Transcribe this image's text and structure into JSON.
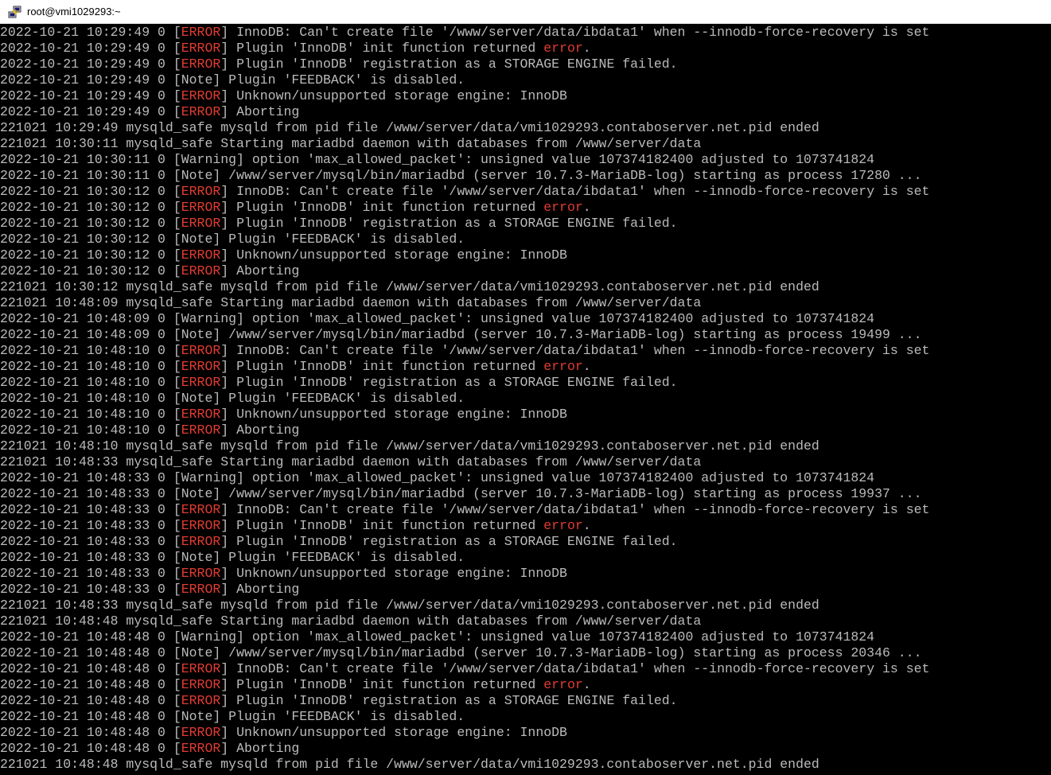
{
  "window": {
    "title": "root@vmi1029293:~",
    "icon": "putty-icon"
  },
  "colors": {
    "terminal_background": "#000000",
    "terminal_foreground": "#bbbbbb",
    "error_red": "#e03c31"
  },
  "terminal": {
    "lines": [
      {
        "pre": "2022-10-21 10:29:49 0 [",
        "red": "ERROR",
        "post": "] InnoDB: Can't create file '/www/server/data/ibdata1' when --innodb-force-recovery is set"
      },
      {
        "pre": "2022-10-21 10:29:49 0 [",
        "red": "ERROR",
        "post": "] Plugin 'InnoDB' init function returned ",
        "red2": "error",
        "post2": "."
      },
      {
        "pre": "2022-10-21 10:29:49 0 [",
        "red": "ERROR",
        "post": "] Plugin 'InnoDB' registration as a STORAGE ENGINE failed."
      },
      {
        "pre": "2022-10-21 10:29:49 0 [Note] Plugin 'FEEDBACK' is disabled."
      },
      {
        "pre": "2022-10-21 10:29:49 0 [",
        "red": "ERROR",
        "post": "] Unknown/unsupported storage engine: InnoDB"
      },
      {
        "pre": "2022-10-21 10:29:49 0 [",
        "red": "ERROR",
        "post": "] Aborting"
      },
      {
        "pre": "221021 10:29:49 mysqld_safe mysqld from pid file /www/server/data/vmi1029293.contaboserver.net.pid ended"
      },
      {
        "pre": "221021 10:30:11 mysqld_safe Starting mariadbd daemon with databases from /www/server/data"
      },
      {
        "pre": "2022-10-21 10:30:11 0 [Warning] option 'max_allowed_packet': unsigned value 107374182400 adjusted to 1073741824"
      },
      {
        "pre": "2022-10-21 10:30:11 0 [Note] /www/server/mysql/bin/mariadbd (server 10.7.3-MariaDB-log) starting as process 17280 ..."
      },
      {
        "pre": "2022-10-21 10:30:12 0 [",
        "red": "ERROR",
        "post": "] InnoDB: Can't create file '/www/server/data/ibdata1' when --innodb-force-recovery is set"
      },
      {
        "pre": "2022-10-21 10:30:12 0 [",
        "red": "ERROR",
        "post": "] Plugin 'InnoDB' init function returned ",
        "red2": "error",
        "post2": "."
      },
      {
        "pre": "2022-10-21 10:30:12 0 [",
        "red": "ERROR",
        "post": "] Plugin 'InnoDB' registration as a STORAGE ENGINE failed."
      },
      {
        "pre": "2022-10-21 10:30:12 0 [Note] Plugin 'FEEDBACK' is disabled."
      },
      {
        "pre": "2022-10-21 10:30:12 0 [",
        "red": "ERROR",
        "post": "] Unknown/unsupported storage engine: InnoDB"
      },
      {
        "pre": "2022-10-21 10:30:12 0 [",
        "red": "ERROR",
        "post": "] Aborting"
      },
      {
        "pre": "221021 10:30:12 mysqld_safe mysqld from pid file /www/server/data/vmi1029293.contaboserver.net.pid ended"
      },
      {
        "pre": "221021 10:48:09 mysqld_safe Starting mariadbd daemon with databases from /www/server/data"
      },
      {
        "pre": "2022-10-21 10:48:09 0 [Warning] option 'max_allowed_packet': unsigned value 107374182400 adjusted to 1073741824"
      },
      {
        "pre": "2022-10-21 10:48:09 0 [Note] /www/server/mysql/bin/mariadbd (server 10.7.3-MariaDB-log) starting as process 19499 ..."
      },
      {
        "pre": "2022-10-21 10:48:10 0 [",
        "red": "ERROR",
        "post": "] InnoDB: Can't create file '/www/server/data/ibdata1' when --innodb-force-recovery is set"
      },
      {
        "pre": "2022-10-21 10:48:10 0 [",
        "red": "ERROR",
        "post": "] Plugin 'InnoDB' init function returned ",
        "red2": "error",
        "post2": "."
      },
      {
        "pre": "2022-10-21 10:48:10 0 [",
        "red": "ERROR",
        "post": "] Plugin 'InnoDB' registration as a STORAGE ENGINE failed."
      },
      {
        "pre": "2022-10-21 10:48:10 0 [Note] Plugin 'FEEDBACK' is disabled."
      },
      {
        "pre": "2022-10-21 10:48:10 0 [",
        "red": "ERROR",
        "post": "] Unknown/unsupported storage engine: InnoDB"
      },
      {
        "pre": "2022-10-21 10:48:10 0 [",
        "red": "ERROR",
        "post": "] Aborting"
      },
      {
        "pre": "221021 10:48:10 mysqld_safe mysqld from pid file /www/server/data/vmi1029293.contaboserver.net.pid ended"
      },
      {
        "pre": "221021 10:48:33 mysqld_safe Starting mariadbd daemon with databases from /www/server/data"
      },
      {
        "pre": "2022-10-21 10:48:33 0 [Warning] option 'max_allowed_packet': unsigned value 107374182400 adjusted to 1073741824"
      },
      {
        "pre": "2022-10-21 10:48:33 0 [Note] /www/server/mysql/bin/mariadbd (server 10.7.3-MariaDB-log) starting as process 19937 ..."
      },
      {
        "pre": "2022-10-21 10:48:33 0 [",
        "red": "ERROR",
        "post": "] InnoDB: Can't create file '/www/server/data/ibdata1' when --innodb-force-recovery is set"
      },
      {
        "pre": "2022-10-21 10:48:33 0 [",
        "red": "ERROR",
        "post": "] Plugin 'InnoDB' init function returned ",
        "red2": "error",
        "post2": "."
      },
      {
        "pre": "2022-10-21 10:48:33 0 [",
        "red": "ERROR",
        "post": "] Plugin 'InnoDB' registration as a STORAGE ENGINE failed."
      },
      {
        "pre": "2022-10-21 10:48:33 0 [Note] Plugin 'FEEDBACK' is disabled."
      },
      {
        "pre": "2022-10-21 10:48:33 0 [",
        "red": "ERROR",
        "post": "] Unknown/unsupported storage engine: InnoDB"
      },
      {
        "pre": "2022-10-21 10:48:33 0 [",
        "red": "ERROR",
        "post": "] Aborting"
      },
      {
        "pre": "221021 10:48:33 mysqld_safe mysqld from pid file /www/server/data/vmi1029293.contaboserver.net.pid ended"
      },
      {
        "pre": "221021 10:48:48 mysqld_safe Starting mariadbd daemon with databases from /www/server/data"
      },
      {
        "pre": "2022-10-21 10:48:48 0 [Warning] option 'max_allowed_packet': unsigned value 107374182400 adjusted to 1073741824"
      },
      {
        "pre": "2022-10-21 10:48:48 0 [Note] /www/server/mysql/bin/mariadbd (server 10.7.3-MariaDB-log) starting as process 20346 ..."
      },
      {
        "pre": "2022-10-21 10:48:48 0 [",
        "red": "ERROR",
        "post": "] InnoDB: Can't create file '/www/server/data/ibdata1' when --innodb-force-recovery is set"
      },
      {
        "pre": "2022-10-21 10:48:48 0 [",
        "red": "ERROR",
        "post": "] Plugin 'InnoDB' init function returned ",
        "red2": "error",
        "post2": "."
      },
      {
        "pre": "2022-10-21 10:48:48 0 [",
        "red": "ERROR",
        "post": "] Plugin 'InnoDB' registration as a STORAGE ENGINE failed."
      },
      {
        "pre": "2022-10-21 10:48:48 0 [Note] Plugin 'FEEDBACK' is disabled."
      },
      {
        "pre": "2022-10-21 10:48:48 0 [",
        "red": "ERROR",
        "post": "] Unknown/unsupported storage engine: InnoDB"
      },
      {
        "pre": "2022-10-21 10:48:48 0 [",
        "red": "ERROR",
        "post": "] Aborting"
      },
      {
        "pre": "221021 10:48:48 mysqld_safe mysqld from pid file /www/server/data/vmi1029293.contaboserver.net.pid ended"
      }
    ]
  }
}
